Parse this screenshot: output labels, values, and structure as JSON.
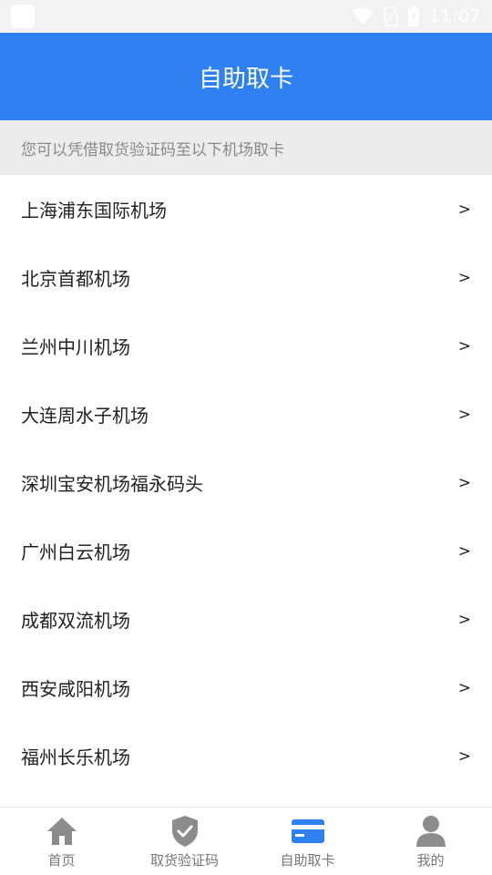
{
  "status_bar": {
    "time": "11:07"
  },
  "header": {
    "title": "自助取卡"
  },
  "notice": {
    "text": "您可以凭借取货验证码至以下机场取卡"
  },
  "airports": [
    {
      "name": "上海浦东国际机场",
      "arrow": ">"
    },
    {
      "name": "北京首都机场",
      "arrow": ">"
    },
    {
      "name": "兰州中川机场",
      "arrow": ">"
    },
    {
      "name": "大连周水子机场",
      "arrow": ">"
    },
    {
      "name": "深圳宝安机场福永码头",
      "arrow": ">"
    },
    {
      "name": "广州白云机场",
      "arrow": ">"
    },
    {
      "name": "成都双流机场",
      "arrow": ">"
    },
    {
      "name": "西安咸阳机场",
      "arrow": ">"
    },
    {
      "name": "福州长乐机场",
      "arrow": ">"
    }
  ],
  "tabbar": {
    "tabs": [
      {
        "label": "首页",
        "icon": "home-icon"
      },
      {
        "label": "取货验证码",
        "icon": "shield-check-icon"
      },
      {
        "label": "自助取卡",
        "icon": "card-icon",
        "active": true
      },
      {
        "label": "我的",
        "icon": "user-icon"
      }
    ]
  },
  "colors": {
    "primary": "#2f80f0",
    "icon_gray": "#8c8c8c",
    "notice_bg": "#ececec"
  }
}
